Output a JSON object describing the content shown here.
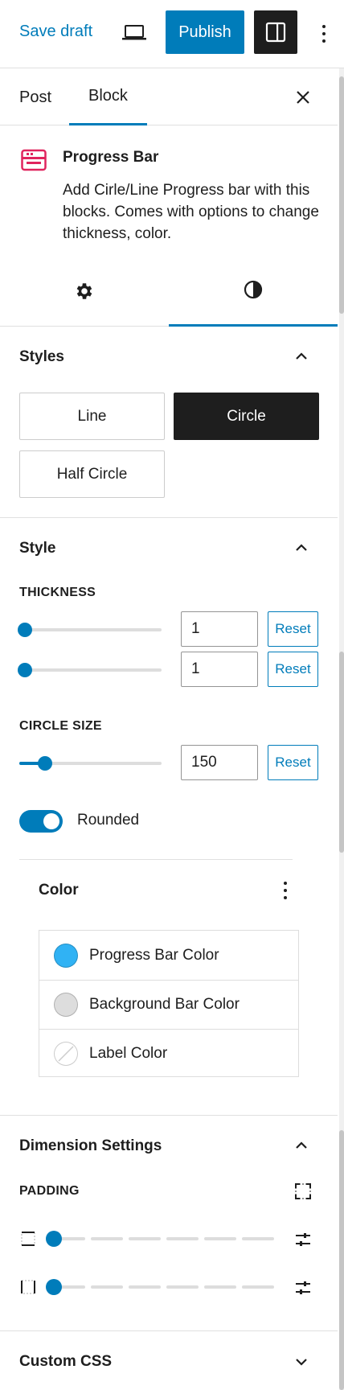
{
  "topbar": {
    "save_draft": "Save draft",
    "publish": "Publish",
    "device_icon": "desktop-icon",
    "sidebar_icon": "sidebar-toggle-icon",
    "more_icon": "more-vertical-icon",
    "accent": "#007cba"
  },
  "sidebar_tabs": {
    "post": "Post",
    "block": "Block",
    "close_icon": "close-icon"
  },
  "block": {
    "title": "Progress Bar",
    "description": "Add Cirle/Line Progress bar with this blocks. Comes with options to change thickness, color.",
    "icon": "progress-bar-icon",
    "icon_color": "#e0245e"
  },
  "inspector_tabs": {
    "settings_icon": "gear-icon",
    "styles_icon": "contrast-icon",
    "active": "styles"
  },
  "styles_panel": {
    "title": "Styles",
    "options": [
      "Line",
      "Circle",
      "Half Circle"
    ],
    "selected": "Circle"
  },
  "style_panel": {
    "title": "Style",
    "thickness_label": "THICKNESS",
    "thickness_values": [
      "1",
      "1"
    ],
    "circle_size_label": "CIRCLE SIZE",
    "circle_size_value": "150",
    "circle_size_fraction": 0.18,
    "reset_label": "Reset",
    "rounded_label": "Rounded",
    "rounded_on": true
  },
  "color_panel": {
    "title": "Color",
    "items": [
      {
        "label": "Progress Bar Color",
        "color": "#30b2f4"
      },
      {
        "label": "Background Bar Color",
        "color": "#dddddd"
      },
      {
        "label": "Label Color",
        "color": "none"
      }
    ]
  },
  "dimension_panel": {
    "title": "Dimension Settings",
    "padding_label": "PADDING"
  },
  "custom_css": {
    "title": "Custom CSS"
  }
}
